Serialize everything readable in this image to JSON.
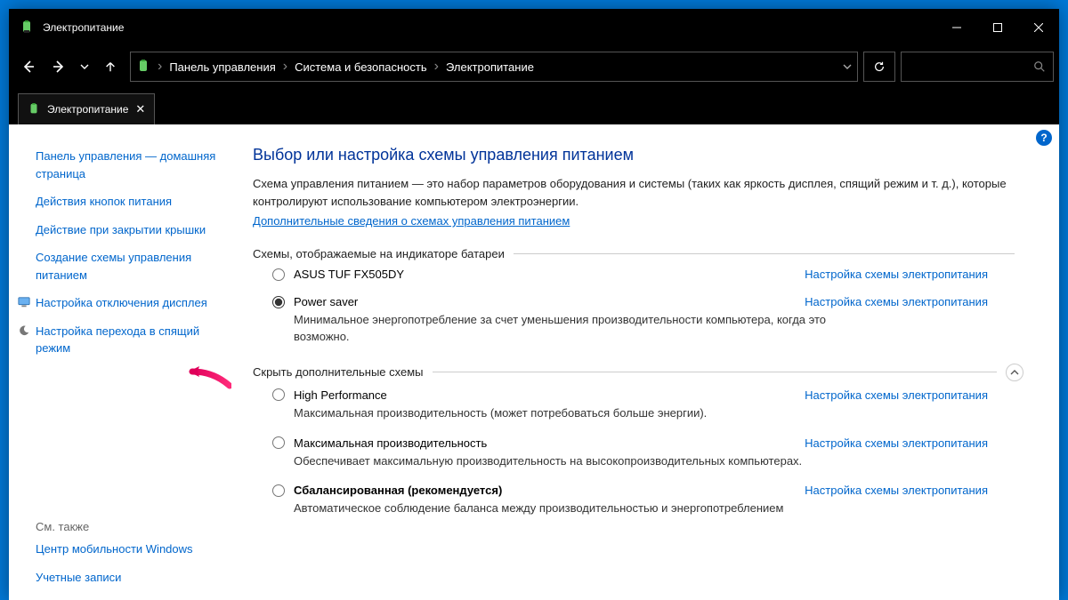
{
  "window": {
    "title": "Электропитание",
    "controls": {
      "min": "—",
      "max": "▢",
      "close": "✕"
    }
  },
  "breadcrumb": {
    "root": "Панель управления",
    "mid": "Система и безопасность",
    "leaf": "Электропитание"
  },
  "tab": {
    "label": "Электропитание"
  },
  "help": "?",
  "sidebar": {
    "items": [
      {
        "label": "Панель управления — домашняя страница"
      },
      {
        "label": "Действия кнопок питания"
      },
      {
        "label": "Действие при закрытии крышки"
      },
      {
        "label": "Создание схемы управления питанием"
      },
      {
        "label": "Настройка отключения дисплея",
        "icon": "monitor"
      },
      {
        "label": "Настройка перехода в спящий режим",
        "icon": "moon"
      }
    ],
    "see_also_heading": "См. также",
    "see_also": [
      "Центр мобильности Windows",
      "Учетные записи"
    ]
  },
  "main": {
    "heading": "Выбор или настройка схемы управления питанием",
    "desc": "Схема управления питанием — это набор параметров оборудования и системы (таких как яркость дисплея, спящий режим и т. д.), которые контролируют использование компьютером электроэнергии.",
    "more_link": "Дополнительные сведения о схемах управления питанием",
    "section_battery": "Схемы, отображаемые на индикаторе батареи",
    "section_extra": "Скрыть дополнительные схемы",
    "plan_action": "Настройка схемы электропитания",
    "plans_battery": [
      {
        "name": "ASUS TUF FX505DY",
        "desc": "",
        "selected": false
      },
      {
        "name": "Power saver",
        "desc": "Минимальное энергопотребление за счет уменьшения производительности компьютера, когда это возможно.",
        "selected": true
      }
    ],
    "plans_extra": [
      {
        "name": "High Performance",
        "desc": "Максимальная производительность (может потребоваться больше энергии).",
        "selected": false,
        "bold": false
      },
      {
        "name": "Максимальная производительность",
        "desc": "Обеспечивает максимальную производительность на высокопроизводительных компьютерах.",
        "selected": false,
        "bold": false
      },
      {
        "name": "Сбалансированная (рекомендуется)",
        "desc": "Автоматическое соблюдение баланса между производительностью и энергопотреблением",
        "selected": false,
        "bold": true
      }
    ]
  }
}
